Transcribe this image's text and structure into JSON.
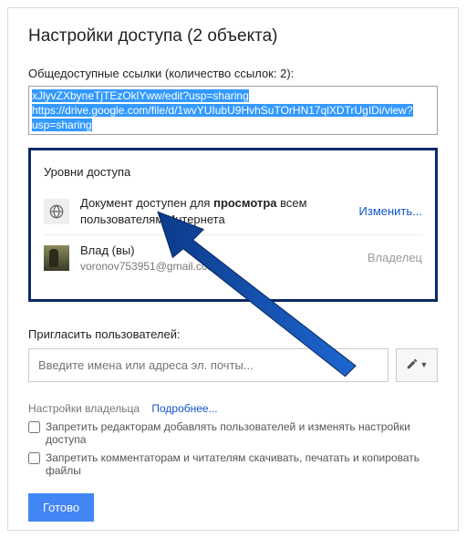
{
  "title": "Настройки доступа (2 объекта)",
  "links_label": "Общедоступные ссылки (количество ссылок: 2):",
  "links": {
    "line1": "xJlyvZXbynеTjTEzOklYww/edit?usp=sharing",
    "line2": "https://drive.google.com/file/d/1wvYUIubU9HvhSuTOrHN17qlXDTrUgIDi/view?",
    "line3": "usp=sharing"
  },
  "access": {
    "title": "Уровни доступа",
    "public_text_before": "Документ доступен для ",
    "public_text_bold": "просмотра",
    "public_text_after": " всем пользователям Интернета",
    "change_label": "Изменить...",
    "user_name": "Влад (вы)",
    "user_email": "voronov753951@gmail.com",
    "owner_label": "Владелец"
  },
  "invite": {
    "label": "Пригласить пользователей:",
    "placeholder": "Введите имена или адреса эл. почты..."
  },
  "owner_settings": {
    "label": "Настройки владельца",
    "more": "Подробнее...",
    "opt1": "Запретить редакторам добавлять пользователей и изменять настройки доступа",
    "opt2": "Запретить комментаторам и читателям скачивать, печатать и копировать файлы"
  },
  "done": "Готово"
}
